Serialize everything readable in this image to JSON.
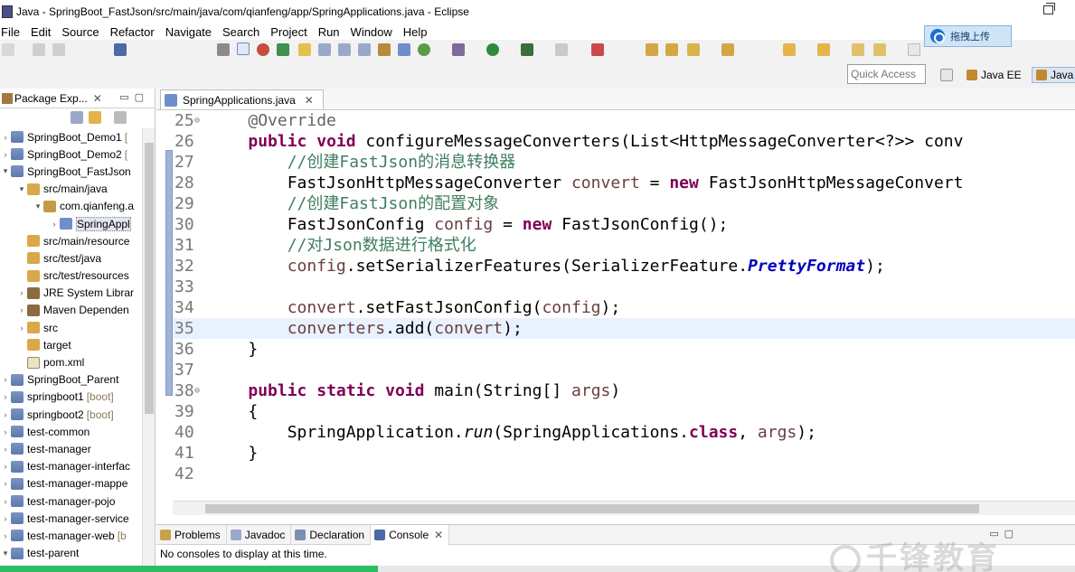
{
  "window": {
    "title": "Java - SpringBoot_FastJson/src/main/java/com/qianfeng/app/SpringApplications.java - Eclipse"
  },
  "menu": [
    "File",
    "Edit",
    "Source",
    "Refactor",
    "Navigate",
    "Search",
    "Project",
    "Run",
    "Window",
    "Help"
  ],
  "toolbar": {
    "upload_label": "拖拽上传",
    "quick_access_placeholder": "Quick Access",
    "perspectives": [
      {
        "label": "Java EE"
      },
      {
        "label": "Java",
        "active": true
      }
    ]
  },
  "package_explorer": {
    "title": "Package Exp...",
    "tree": [
      {
        "label": "SpringBoot_Demo1",
        "extra": "[",
        "depth": 0,
        "expanded": false,
        "icon": "project-icon"
      },
      {
        "label": "SpringBoot_Demo2",
        "extra": "[",
        "depth": 0,
        "expanded": false,
        "icon": "project-icon"
      },
      {
        "label": "SpringBoot_FastJson",
        "extra": "",
        "depth": 0,
        "expanded": true,
        "icon": "project-icon"
      },
      {
        "label": "src/main/java",
        "extra": "",
        "depth": 1,
        "expanded": true,
        "icon": "source-folder-icon"
      },
      {
        "label": "com.qianfeng.a",
        "extra": "",
        "depth": 2,
        "expanded": true,
        "icon": "package-icon"
      },
      {
        "label": "SpringAppl",
        "extra": "",
        "depth": 3,
        "expanded": false,
        "icon": "java-file-icon",
        "selected": true
      },
      {
        "label": "src/main/resource",
        "extra": "",
        "depth": 1,
        "leaf": true,
        "icon": "source-folder-icon"
      },
      {
        "label": "src/test/java",
        "extra": "",
        "depth": 1,
        "leaf": true,
        "icon": "source-folder-icon"
      },
      {
        "label": "src/test/resources",
        "extra": "",
        "depth": 1,
        "leaf": true,
        "icon": "source-folder-icon"
      },
      {
        "label": "JRE System Librar",
        "extra": "",
        "depth": 1,
        "expanded": false,
        "icon": "library-icon"
      },
      {
        "label": "Maven Dependen",
        "extra": "",
        "depth": 1,
        "expanded": false,
        "icon": "library-icon"
      },
      {
        "label": "src",
        "extra": "",
        "depth": 1,
        "expanded": false,
        "icon": "folder-icon"
      },
      {
        "label": "target",
        "extra": "",
        "depth": 1,
        "leaf": true,
        "icon": "folder-icon"
      },
      {
        "label": "pom.xml",
        "extra": "",
        "depth": 1,
        "leaf": true,
        "icon": "xml-file-icon"
      },
      {
        "label": "SpringBoot_Parent",
        "extra": "",
        "depth": 0,
        "expanded": false,
        "icon": "project-icon"
      },
      {
        "label": "springboot1",
        "extra": "[boot]",
        "depth": 0,
        "expanded": false,
        "icon": "project-icon"
      },
      {
        "label": "springboot2",
        "extra": "[boot]",
        "depth": 0,
        "expanded": false,
        "icon": "project-icon"
      },
      {
        "label": "test-common",
        "extra": "",
        "depth": 0,
        "expanded": false,
        "icon": "project-icon"
      },
      {
        "label": "test-manager",
        "extra": "",
        "depth": 0,
        "expanded": false,
        "icon": "project-icon"
      },
      {
        "label": "test-manager-interfac",
        "extra": "",
        "depth": 0,
        "expanded": false,
        "icon": "project-icon"
      },
      {
        "label": "test-manager-mappe",
        "extra": "",
        "depth": 0,
        "expanded": false,
        "icon": "project-icon"
      },
      {
        "label": "test-manager-pojo",
        "extra": "",
        "depth": 0,
        "expanded": false,
        "icon": "project-icon"
      },
      {
        "label": "test-manager-service",
        "extra": "",
        "depth": 0,
        "expanded": false,
        "icon": "project-icon"
      },
      {
        "label": "test-manager-web",
        "extra": "[b",
        "depth": 0,
        "expanded": false,
        "icon": "project-icon"
      },
      {
        "label": "test-parent",
        "extra": "",
        "depth": 0,
        "expanded": true,
        "icon": "project-icon"
      }
    ]
  },
  "editor": {
    "tab_label": "SpringApplications.java",
    "lines": [
      {
        "num": "25",
        "fold": true,
        "tokens": [
          [
            "    ",
            ""
          ],
          [
            "@Override",
            "an"
          ]
        ]
      },
      {
        "num": "26",
        "tokens": [
          [
            "    ",
            ""
          ],
          [
            "public",
            "kw"
          ],
          [
            " ",
            ""
          ],
          [
            "void",
            "kw"
          ],
          [
            " configureMessageConverters(List<HttpMessageConverter<?>> conv",
            ""
          ]
        ]
      },
      {
        "num": "27",
        "tokens": [
          [
            "        ",
            ""
          ],
          [
            "//创建FastJson的消息转换器",
            "cm"
          ]
        ]
      },
      {
        "num": "28",
        "tokens": [
          [
            "        FastJsonHttpMessageConverter ",
            ""
          ],
          [
            "convert",
            "var"
          ],
          [
            " = ",
            ""
          ],
          [
            "new",
            "kw"
          ],
          [
            " FastJsonHttpMessageConvert",
            ""
          ]
        ]
      },
      {
        "num": "29",
        "tokens": [
          [
            "        ",
            ""
          ],
          [
            "//创建FastJson的配置对象",
            "cm"
          ]
        ]
      },
      {
        "num": "30",
        "tokens": [
          [
            "        FastJsonConfig ",
            ""
          ],
          [
            "config",
            "var"
          ],
          [
            " = ",
            ""
          ],
          [
            "new",
            "kw"
          ],
          [
            " FastJsonConfig();",
            ""
          ]
        ]
      },
      {
        "num": "31",
        "tokens": [
          [
            "        ",
            ""
          ],
          [
            "//对Json数据进行格式化",
            "cm"
          ]
        ]
      },
      {
        "num": "32",
        "tokens": [
          [
            "        ",
            ""
          ],
          [
            "config",
            "var"
          ],
          [
            ".setSerializerFeatures(SerializerFeature.",
            ""
          ],
          [
            "PrettyFormat",
            "fld"
          ],
          [
            ");",
            ""
          ]
        ]
      },
      {
        "num": "33",
        "tokens": [
          [
            "",
            ""
          ]
        ]
      },
      {
        "num": "34",
        "tokens": [
          [
            "        ",
            ""
          ],
          [
            "convert",
            "var"
          ],
          [
            ".setFastJsonConfig(",
            ""
          ],
          [
            "config",
            "var"
          ],
          [
            ");",
            ""
          ]
        ]
      },
      {
        "num": "35",
        "current": true,
        "tokens": [
          [
            "        ",
            ""
          ],
          [
            "converters",
            "var"
          ],
          [
            ".add(",
            ""
          ],
          [
            "convert",
            "var"
          ],
          [
            ");",
            ""
          ]
        ]
      },
      {
        "num": "36",
        "tokens": [
          [
            "    }",
            ""
          ]
        ]
      },
      {
        "num": "37",
        "tokens": [
          [
            "",
            ""
          ]
        ]
      },
      {
        "num": "38",
        "fold": true,
        "tokens": [
          [
            "    ",
            ""
          ],
          [
            "public",
            "kw"
          ],
          [
            " ",
            ""
          ],
          [
            "static",
            "kw"
          ],
          [
            " ",
            ""
          ],
          [
            "void",
            "kw"
          ],
          [
            " main(String[] ",
            ""
          ],
          [
            "args",
            "var"
          ],
          [
            ")",
            ""
          ]
        ]
      },
      {
        "num": "39",
        "tokens": [
          [
            "    {",
            ""
          ]
        ]
      },
      {
        "num": "40",
        "tokens": [
          [
            "        SpringApplication.",
            ""
          ],
          [
            "run",
            "it"
          ],
          [
            "(SpringApplications.",
            ""
          ],
          [
            "class",
            "kw"
          ],
          [
            ", ",
            ""
          ],
          [
            "args",
            "var"
          ],
          [
            ");",
            ""
          ]
        ]
      },
      {
        "num": "41",
        "tokens": [
          [
            "    }",
            ""
          ]
        ]
      },
      {
        "num": "42",
        "tokens": [
          [
            "",
            ""
          ]
        ]
      }
    ]
  },
  "bottom_panel": {
    "tabs": [
      {
        "label": "Problems"
      },
      {
        "label": "Javadoc"
      },
      {
        "label": "Declaration"
      },
      {
        "label": "Console",
        "active": true
      }
    ],
    "console_message": "No consoles to display at this time."
  },
  "watermark_text": "千锋教育",
  "colors": {
    "keyword": "#7f0055",
    "comment": "#3f7f5f",
    "variable": "#6a3e3e",
    "field": "#0000c0",
    "progress": "#2bbd61"
  }
}
